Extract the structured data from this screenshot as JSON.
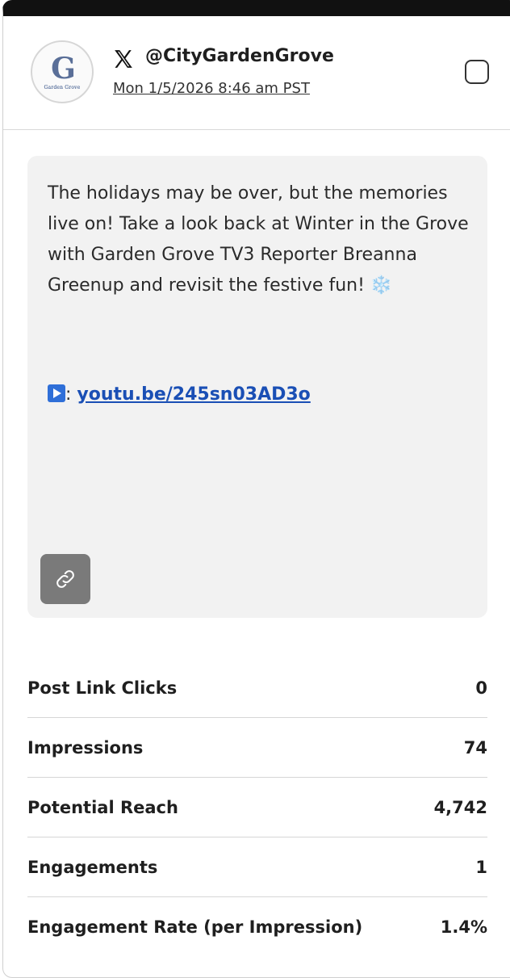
{
  "account": {
    "handle": "@CityGardenGrove",
    "timestamp": "Mon 1/5/2026 8:46 am PST",
    "avatar_logo": "G",
    "avatar_caption": "Garden Grove",
    "platform_icon": "x-logo-icon"
  },
  "post": {
    "text": "The holidays may be over, but the memories live on! Take a look back at Winter in the Grove with Garden Grove TV3 Reporter Breanna Greenup and revisit the festive fun!",
    "emoji": "❄️",
    "link_separator": ":",
    "link_text": "youtu.be/245sn03AD3o"
  },
  "stats": [
    {
      "label": "Post Link Clicks",
      "value": "0"
    },
    {
      "label": "Impressions",
      "value": "74"
    },
    {
      "label": "Potential Reach",
      "value": "4,742"
    },
    {
      "label": "Engagements",
      "value": "1"
    },
    {
      "label": "Engagement Rate (per Impression)",
      "value": "1.4%"
    }
  ],
  "colors": {
    "top_bar": "#111111",
    "link": "#1a4fb5",
    "post_bg": "#f2f2f2",
    "link_button_bg": "#7a7a7a"
  }
}
